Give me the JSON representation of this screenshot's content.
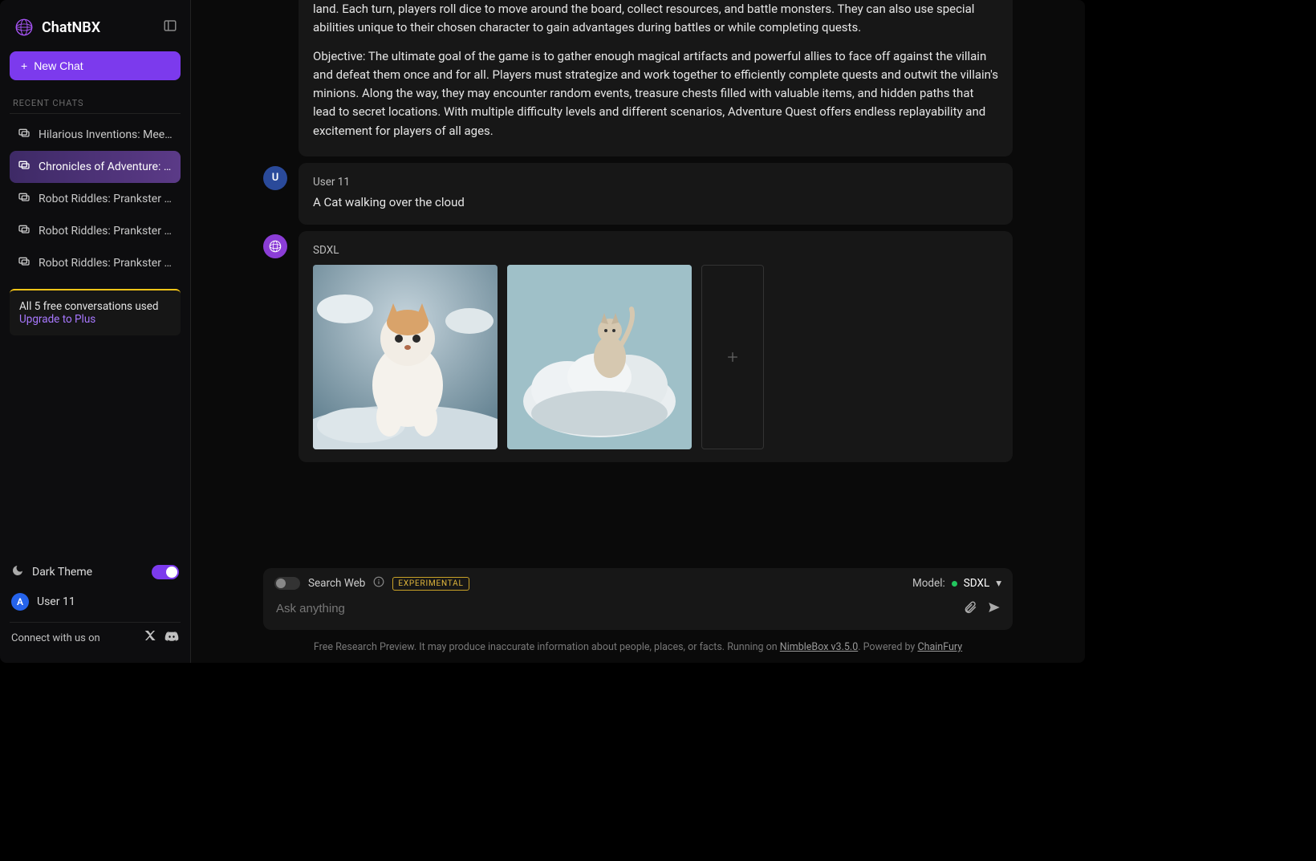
{
  "brand": {
    "name": "ChatNBX"
  },
  "sidebar": {
    "newChatLabel": "New Chat",
    "recentHeader": "RECENT CHATS",
    "items": [
      {
        "label": "Hilarious Inventions: Meet...",
        "active": false
      },
      {
        "label": "Chronicles of Adventure: A...",
        "active": true
      },
      {
        "label": "Robot Riddles: Prankster B...",
        "active": false
      },
      {
        "label": "Robot Riddles: Prankster B...",
        "active": false
      },
      {
        "label": "Robot Riddles: Prankster B...",
        "active": false
      }
    ],
    "quota": {
      "line1": "All 5 free conversations used",
      "upgrade": "Upgrade to Plus"
    },
    "themeLabel": "Dark Theme",
    "user": {
      "initial": "A",
      "name": "User 11"
    },
    "connect": "Connect with us on"
  },
  "conversation": {
    "assistantTopParagraphs": [
      "land. Each turn, players roll dice to move around the board, collect resources, and battle monsters. They can also use special abilities unique to their chosen character to gain advantages during battles or while completing quests.",
      "Objective: The ultimate goal of the game is to gather enough magical artifacts and powerful allies to face off against the villain and defeat them once and for all. Players must strategize and work together to efficiently complete quests and outwit the villain's minions. Along the way, they may encounter random events, treasure chests filled with valuable items, and hidden paths that lead to secret locations. With multiple difficulty levels and different scenarios, Adventure Quest offers endless replayability and excitement for players of all ages."
    ],
    "userMsg": {
      "initial": "U",
      "name": "User 11",
      "text": "A Cat walking over the cloud"
    },
    "sdxl": {
      "name": "SDXL"
    }
  },
  "composer": {
    "searchWeb": "Search Web",
    "experimental": "EXPERIMENTAL",
    "modelLabel": "Model:",
    "modelName": "SDXL",
    "placeholder": "Ask anything"
  },
  "footer": {
    "prefix": "Free Research Preview. It may produce inaccurate information about people, places, or facts. Running on ",
    "link1": "NimbleBox v3.5.0",
    "middle": ". Powered by ",
    "link2": "ChainFury"
  }
}
